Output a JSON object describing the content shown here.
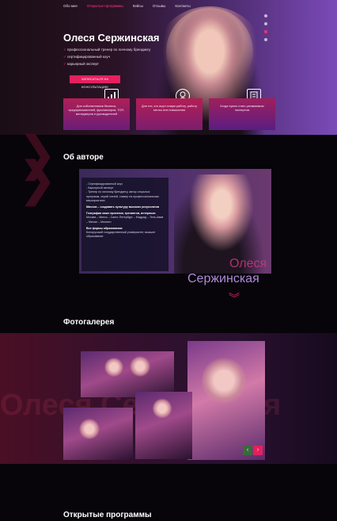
{
  "nav": [
    "Обо мне",
    "Открытые программы",
    "Кейсы",
    "Отзывы",
    "Контакты"
  ],
  "hero": {
    "title": "Олеся Сержинская",
    "bullets": [
      "профессиональный тренер по личному брендингу",
      "сертифицированный коуч",
      "карьерный эксперт"
    ],
    "button": "ЗАПИСАТЬСЯ НА КОНСУЛЬТАЦИЮ",
    "cards": [
      "Для собственников бизнеса, предпринимателей, фрилансеров, ТОП-менеджеров и руководителей",
      "Для тех, кто ищет новую работу, работу мечты или повышения",
      "Когда нужно стать узнаваемым экспертом"
    ],
    "icons": [
      "chart-icon",
      "money-hand-icon",
      "document-icon"
    ]
  },
  "about": {
    "title": "Об авторе",
    "bullets": [
      "- Сертифицированный коуч",
      "- Карьерный эксперт",
      "- Тренер по личному брендингу, автор открытых программ, серий статей, спикер на профессиональных мероприятиях"
    ],
    "mission": "Миссия – создавать культуру высоких результатов",
    "geo_label": "География моих проектов, тренингов, интервью:",
    "geo": "Москва – Минск – Санкт-Петербург – Мадрид – Тель-Авив – Милан – Мюнхен",
    "edu_label": "Все формы образования:",
    "edu": "Белорусский государственный университет, высшее образование",
    "name_first": "Олеся",
    "name_last": "Сержинская"
  },
  "gallery": {
    "title": "Фотогалерея",
    "ghost": "Олеся Сержинская",
    "prev": "‹",
    "next": "›"
  },
  "programs": {
    "title": "Открытые программы"
  },
  "colors": {
    "accent": "#e4205f",
    "violet": "#7b4ab8"
  }
}
